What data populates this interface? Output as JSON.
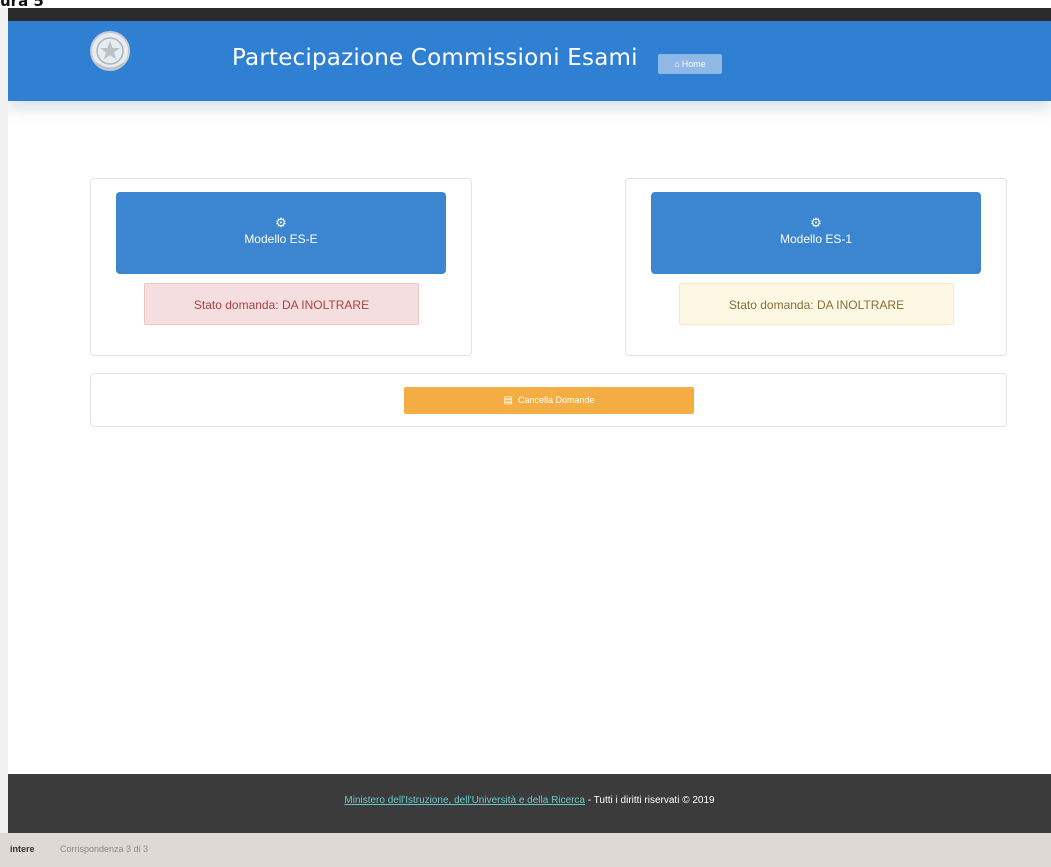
{
  "frame": {
    "caption_fragment": "ura 5"
  },
  "header": {
    "title": "Partecipazione Commissioni Esami",
    "home_label": "Home",
    "home_icon": "home-icon",
    "emblem": "emblem-icon",
    "color": "#2f7fd3"
  },
  "cards": [
    {
      "model_label": "Modello ES-E",
      "model_icon": "gears-icon",
      "status": "Stato domanda: DA INOLTRARE",
      "status_color": "#f4dedf"
    },
    {
      "model_label": "Modello ES-1",
      "model_icon": "gears-icon",
      "status": "Stato domanda: DA INOLTRARE",
      "status_color": "#fcf8e3"
    }
  ],
  "actions": {
    "delete_label": "Cancella Domande",
    "delete_icon": "save-icon",
    "color": "#f4ad42"
  },
  "footer": {
    "link_text": "Ministero dell'Istruzione, dell'Università e della Ricerca",
    "rest_text": " - Tutti i diritti riservati © 2019"
  },
  "find_bar": {
    "label": "intere",
    "count": "Corrispondenza 3 di 3"
  }
}
